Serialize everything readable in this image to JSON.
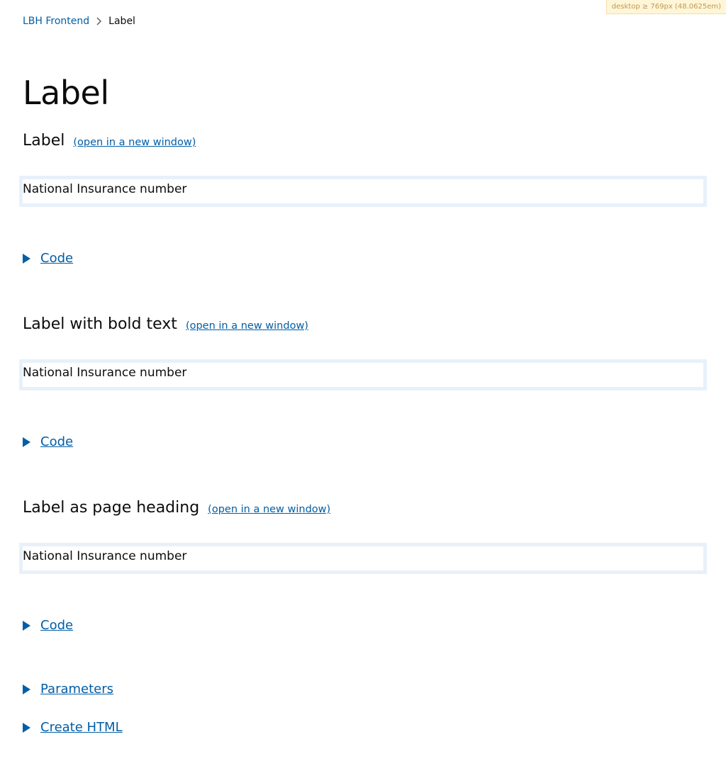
{
  "breakpoint_badge": "desktop ≥ 769px (48.0625em)",
  "breadcrumb": {
    "home": "LBH Frontend",
    "current": "Label"
  },
  "page": {
    "title": "Label"
  },
  "sections": [
    {
      "heading": "Label",
      "open_link": "(open in a new window)",
      "example_label": "National Insurance number",
      "code_toggle": "Code"
    },
    {
      "heading": "Label with bold text",
      "open_link": "(open in a new window)",
      "example_label": "National Insurance number",
      "code_toggle": "Code"
    },
    {
      "heading": "Label as page heading",
      "open_link": "(open in a new window)",
      "example_label": "National Insurance number",
      "code_toggle": "Code"
    }
  ],
  "extra_toggles": {
    "parameters": "Parameters",
    "create_html": "Create HTML"
  },
  "colors": {
    "link": "#025ea6",
    "text": "#0b0c0c",
    "frame_border": "#e8f1fa",
    "badge_bg": "#fff6d8",
    "badge_text": "#c09853"
  },
  "icons": {
    "breadcrumb_separator": "chevron-right-icon",
    "disclosure": "triangle-right-icon"
  }
}
